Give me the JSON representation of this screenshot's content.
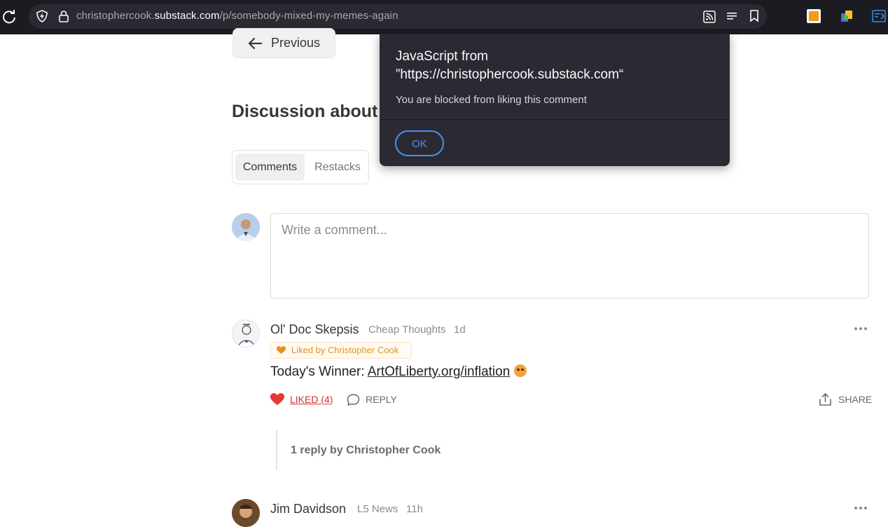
{
  "browser": {
    "url_prefix": "christophercook.",
    "url_host": "substack.com",
    "url_path": "/p/somebody-mixed-my-memes-again"
  },
  "page": {
    "previous_label": "Previous",
    "discussion_title": "Discussion about t",
    "tabs": [
      {
        "label": "Comments",
        "active": true
      },
      {
        "label": "Restacks",
        "active": false
      }
    ],
    "comment_placeholder": "Write a comment..."
  },
  "comments": [
    {
      "author": "Ol' Doc Skepsis",
      "publication": "Cheap Thoughts",
      "time": "1d",
      "liked_by": "Liked by Christopher Cook",
      "body_prefix": "Today's Winner: ",
      "link_text": "ArtOfLiberty.org/inflation",
      "like_label": "LIKED (4)",
      "reply_label": "REPLY",
      "share_label": "SHARE",
      "replies_label": "1 reply by Christopher Cook"
    },
    {
      "author": "Jim Davidson",
      "publication": "L5 News",
      "time": "11h"
    }
  ],
  "dialog": {
    "title": "JavaScript from ”https://christophercook.substack.com“",
    "message": "You are blocked from liking this comment",
    "ok_label": "OK"
  },
  "colors": {
    "liked_red": "#d32f2f",
    "badge_orange": "#e8901a",
    "dialog_bg": "#2b2a33",
    "ok_blue": "#4a8ff0"
  }
}
